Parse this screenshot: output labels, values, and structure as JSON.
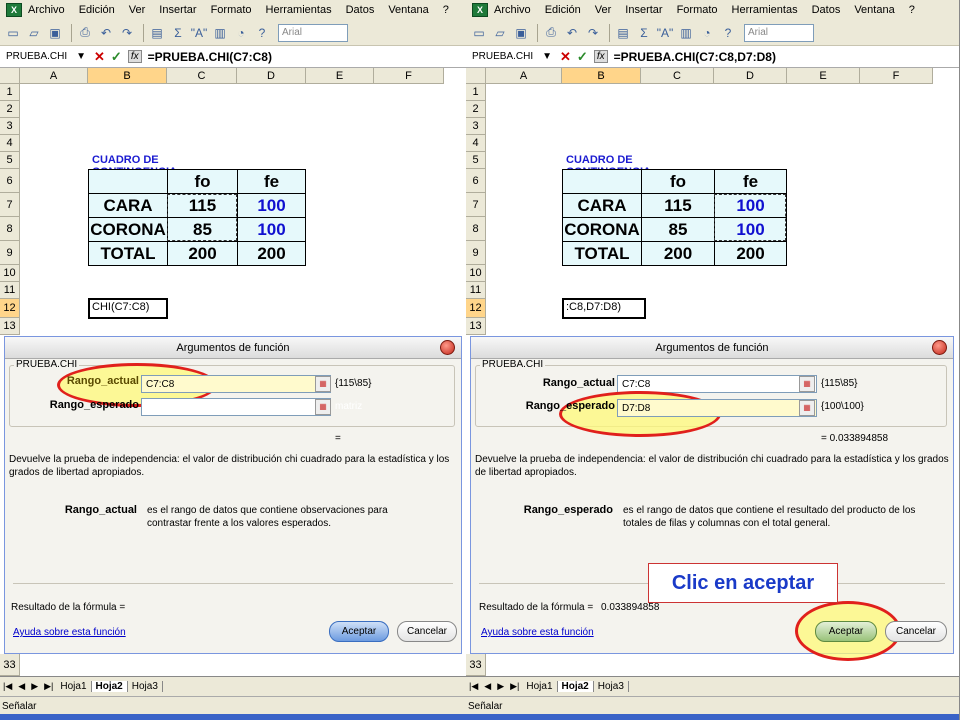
{
  "menu": {
    "items": [
      "Archivo",
      "Edición",
      "Ver",
      "Insertar",
      "Formato",
      "Herramientas",
      "Datos",
      "Ventana",
      "?"
    ],
    "logo": "X"
  },
  "toolbar": {
    "font_name": "Arial",
    "icons": [
      "new-icon",
      "open-icon",
      "save-icon",
      "print-icon",
      "undo-icon",
      "redo-icon",
      "paste-icon",
      "sum-icon",
      "sort-icon",
      "chart-icon",
      "zoom-icon",
      "help-icon"
    ],
    "sum_glyph": "Σ",
    "sort_glyph": "\"A\""
  },
  "left": {
    "namebox": "PRUEBA.CHI",
    "formula": "=PRUEBA.CHI(C7:C8)",
    "active_cell_text": "CHI(C7:C8)",
    "dialog": {
      "title": "Argumentos de función",
      "group_label": "PRUEBA.CHI",
      "arg1_label": "Rango_actual",
      "arg1_value": "C7:C8",
      "arg1_result": "{115\\85}",
      "arg2_label": "Rango_esperado",
      "arg2_value": "",
      "arg2_result": "matriz",
      "result_eq": "=",
      "description": "Devuelve la prueba de independencia: el valor de distribución chi cuadrado para la estadística y los grados de libertad apropiados.",
      "help_arg": "Rango_actual",
      "help_text": "es el rango de datos que contiene observaciones para contrastar frente a los valores esperados.",
      "formula_result_label": "Resultado de la fórmula =",
      "formula_result_value": "",
      "help_link": "Ayuda sobre esta función",
      "ok": "Aceptar",
      "cancel": "Cancelar"
    }
  },
  "right": {
    "namebox": "PRUEBA.CHI",
    "formula": "=PRUEBA.CHI(C7:C8,D7:D8)",
    "active_cell_text": ":C8,D7:D8)",
    "dialog": {
      "title": "Argumentos de función",
      "group_label": "PRUEBA.CHI",
      "arg1_label": "Rango_actual",
      "arg1_value": "C7:C8",
      "arg1_result": "{115\\85}",
      "arg2_label": "Rango_esperado",
      "arg2_value": "D7:D8",
      "arg2_result": "{100\\100}",
      "result_eq": "= 0.033894858",
      "description": "Devuelve la prueba de independencia: el valor de distribución chi cuadrado para la estadística y los grados de libertad apropiados.",
      "help_arg": "Rango_esperado",
      "help_text": "es el rango de datos que contiene el resultado del producto de los totales de filas y columnas con el total general.",
      "formula_result_label": "Resultado de la fórmula =",
      "formula_result_value": "0.033894858",
      "help_link": "Ayuda sobre esta función",
      "ok": "Aceptar",
      "cancel": "Cancelar"
    }
  },
  "sheet": {
    "columns": [
      "A",
      "B",
      "C",
      "D",
      "E",
      "F"
    ],
    "rows": [
      "1",
      "2",
      "3",
      "4",
      "5",
      "6",
      "7",
      "8",
      "9",
      "10",
      "11",
      "12",
      "13"
    ],
    "row33": "33",
    "table_title": "CUADRO DE CONTINGENCIA",
    "headers": [
      "",
      "fo",
      "fe"
    ],
    "data": [
      [
        "CARA",
        "115",
        "100"
      ],
      [
        "CORONA",
        "85",
        "100"
      ],
      [
        "TOTAL",
        "200",
        "200"
      ]
    ],
    "tabs": [
      "Hoja1",
      "Hoja2",
      "Hoja3"
    ],
    "status": "Señalar"
  },
  "callout": "Clic en aceptar",
  "colors": {
    "accent_blue": "#1a1ad0",
    "cell_bg": "#e6f9fb",
    "highlight_red": "#e0201c",
    "highlight_yellow": "#fffa78"
  }
}
